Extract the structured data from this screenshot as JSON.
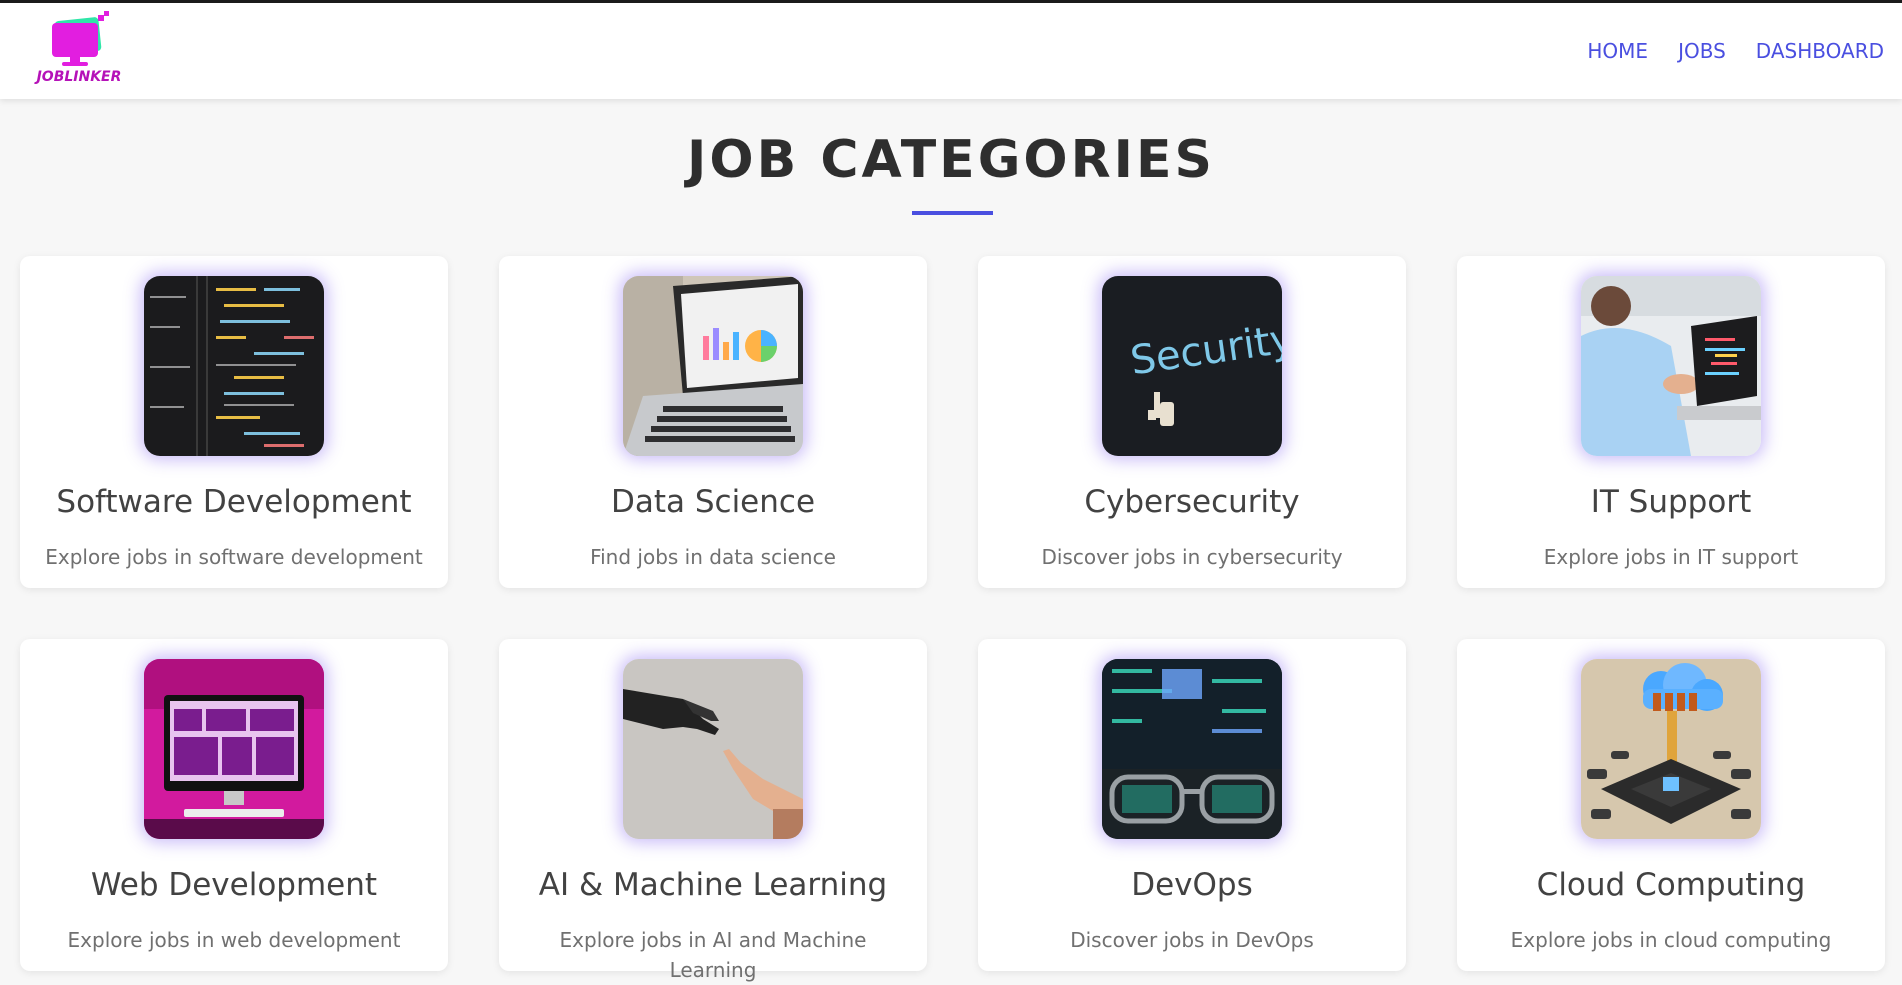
{
  "brand": {
    "logo_text": "JOBLINKER",
    "accent": "#4a4fe0",
    "logo_color": "#e21ee0"
  },
  "nav": {
    "items": [
      "HOME",
      "JOBS",
      "DASHBOARD"
    ]
  },
  "page": {
    "title": "JOB CATEGORIES"
  },
  "categories": [
    {
      "title": "Software Development",
      "description": "Explore jobs in software development",
      "icon": "code-screen-image"
    },
    {
      "title": "Data Science",
      "description": "Find jobs in data science",
      "icon": "laptop-charts-image"
    },
    {
      "title": "Cybersecurity",
      "description": "Discover jobs in cybersecurity",
      "icon": "security-screen-image"
    },
    {
      "title": "IT Support",
      "description": "Explore jobs in IT support",
      "icon": "person-laptop-image"
    },
    {
      "title": "Web Development",
      "description": "Explore jobs in web development",
      "icon": "desktop-monitor-image"
    },
    {
      "title": "AI & Machine Learning",
      "description": "Explore jobs in AI and Machine Learning",
      "icon": "robot-hand-image"
    },
    {
      "title": "DevOps",
      "description": "Discover jobs in DevOps",
      "icon": "code-glasses-image"
    },
    {
      "title": "Cloud Computing",
      "description": "Explore jobs in cloud computing",
      "icon": "cloud-chip-image"
    }
  ]
}
